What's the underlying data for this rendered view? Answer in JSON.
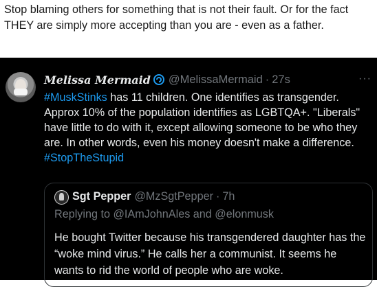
{
  "caption": "Stop blaming others for something that is not their fault. Or for the fact THEY are simply more accepting than you are - even as a father.",
  "tweet": {
    "display_name": "Melissa Mermaid",
    "handle": "@MelissaMermaid",
    "separator": "·",
    "time": "27s",
    "more": "···",
    "hashtag_1": "#MuskStinks",
    "text": " has 11 children. One identifies as transgender. Approx 10% of the population identifies as LGBTQA+. \"Liberals\" have little to do with it, except allowing someone to be who they are.  In other words, even his money doesn't make a difference. ",
    "hashtag_2": "#StopTheStupid",
    "verified_icon": "verified-badge-icon",
    "accent_color": "#1d9bf0"
  },
  "quote": {
    "display_name": "Sgt Pepper",
    "handle": "@MzSgtPepper",
    "separator": "·",
    "time": "7h",
    "replying": "Replying to @IAmJohnAles and @elonmusk",
    "text": "He bought Twitter because his transgendered daughter has the “woke mind virus.” He calls her a communist. It seems he wants to rid the world of people who are woke."
  }
}
